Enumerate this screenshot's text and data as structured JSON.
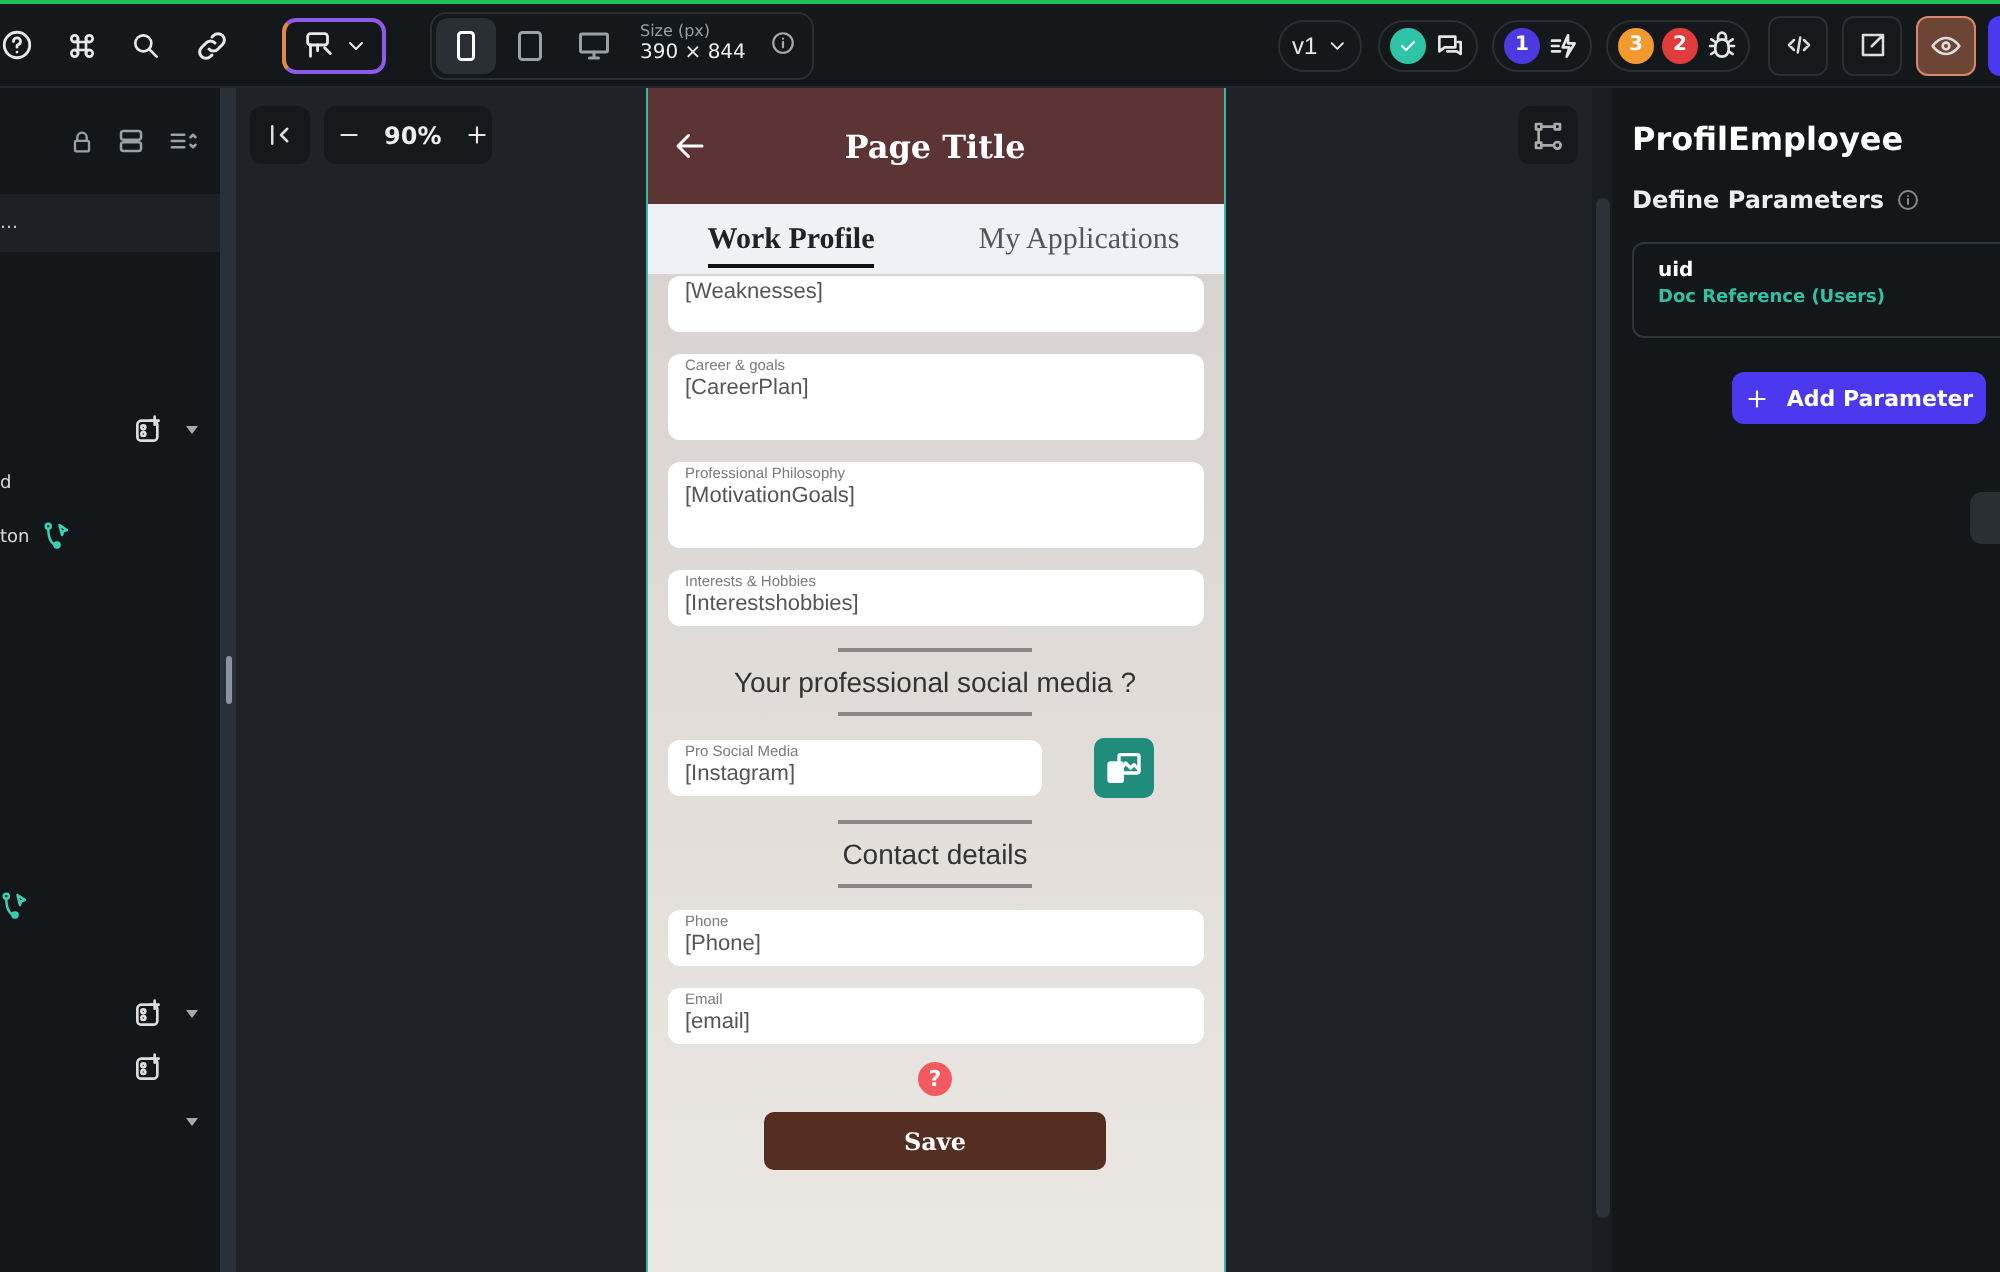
{
  "toolbar": {
    "devices": [
      {
        "kind": "phone",
        "selected": true
      },
      {
        "kind": "tablet",
        "selected": false
      },
      {
        "kind": "desktop",
        "selected": false
      }
    ],
    "size_label": "Size (px)",
    "size_value": "390 × 844",
    "version": "v1",
    "badges": [
      {
        "count": "1",
        "color": "#4b3ae0"
      },
      {
        "count": "3",
        "color": "#f29a2e"
      },
      {
        "count": "2",
        "color": "#e23b3b"
      }
    ]
  },
  "left_panel": {
    "selected_item": "…",
    "items": [
      {
        "label": "d",
        "kind": "text"
      },
      {
        "label": "ton",
        "kind": "action"
      }
    ]
  },
  "canvas": {
    "zoom": "90%"
  },
  "phone": {
    "title": "Page Title",
    "tabs": [
      {
        "label": "Work Profile",
        "selected": true
      },
      {
        "label": "My Applications",
        "selected": false
      }
    ],
    "sections": [
      {
        "kind": "field",
        "value": "[Weaknesses]",
        "multiline": false
      },
      {
        "kind": "field",
        "label": "Career & goals",
        "value": "[CareerPlan]",
        "multiline": true
      },
      {
        "kind": "field",
        "label": "Professional Philosophy",
        "value": "[MotivationGoals]",
        "multiline": true
      },
      {
        "kind": "field",
        "label": "Interests & Hobbies",
        "value": "[Interestshobbies]",
        "multiline": false
      },
      {
        "kind": "heading",
        "text": "Your professional social media ?"
      },
      {
        "kind": "field_with_button",
        "label": "Pro Social Media",
        "value": "[Instagram]",
        "multiline": false
      },
      {
        "kind": "heading",
        "text": "Contact details"
      },
      {
        "kind": "field",
        "label": "Phone",
        "value": "[Phone]",
        "multiline": false
      },
      {
        "kind": "field",
        "label": "Email",
        "value": "[email]",
        "multiline": false
      }
    ],
    "help": "?",
    "save_button": "Save"
  },
  "right_panel": {
    "title": "ProfilEmployee",
    "subtitle": "Define Parameters",
    "parameters": [
      {
        "name": "uid",
        "type": "Doc Reference (Users)"
      }
    ],
    "add_button": "Add Parameter"
  }
}
